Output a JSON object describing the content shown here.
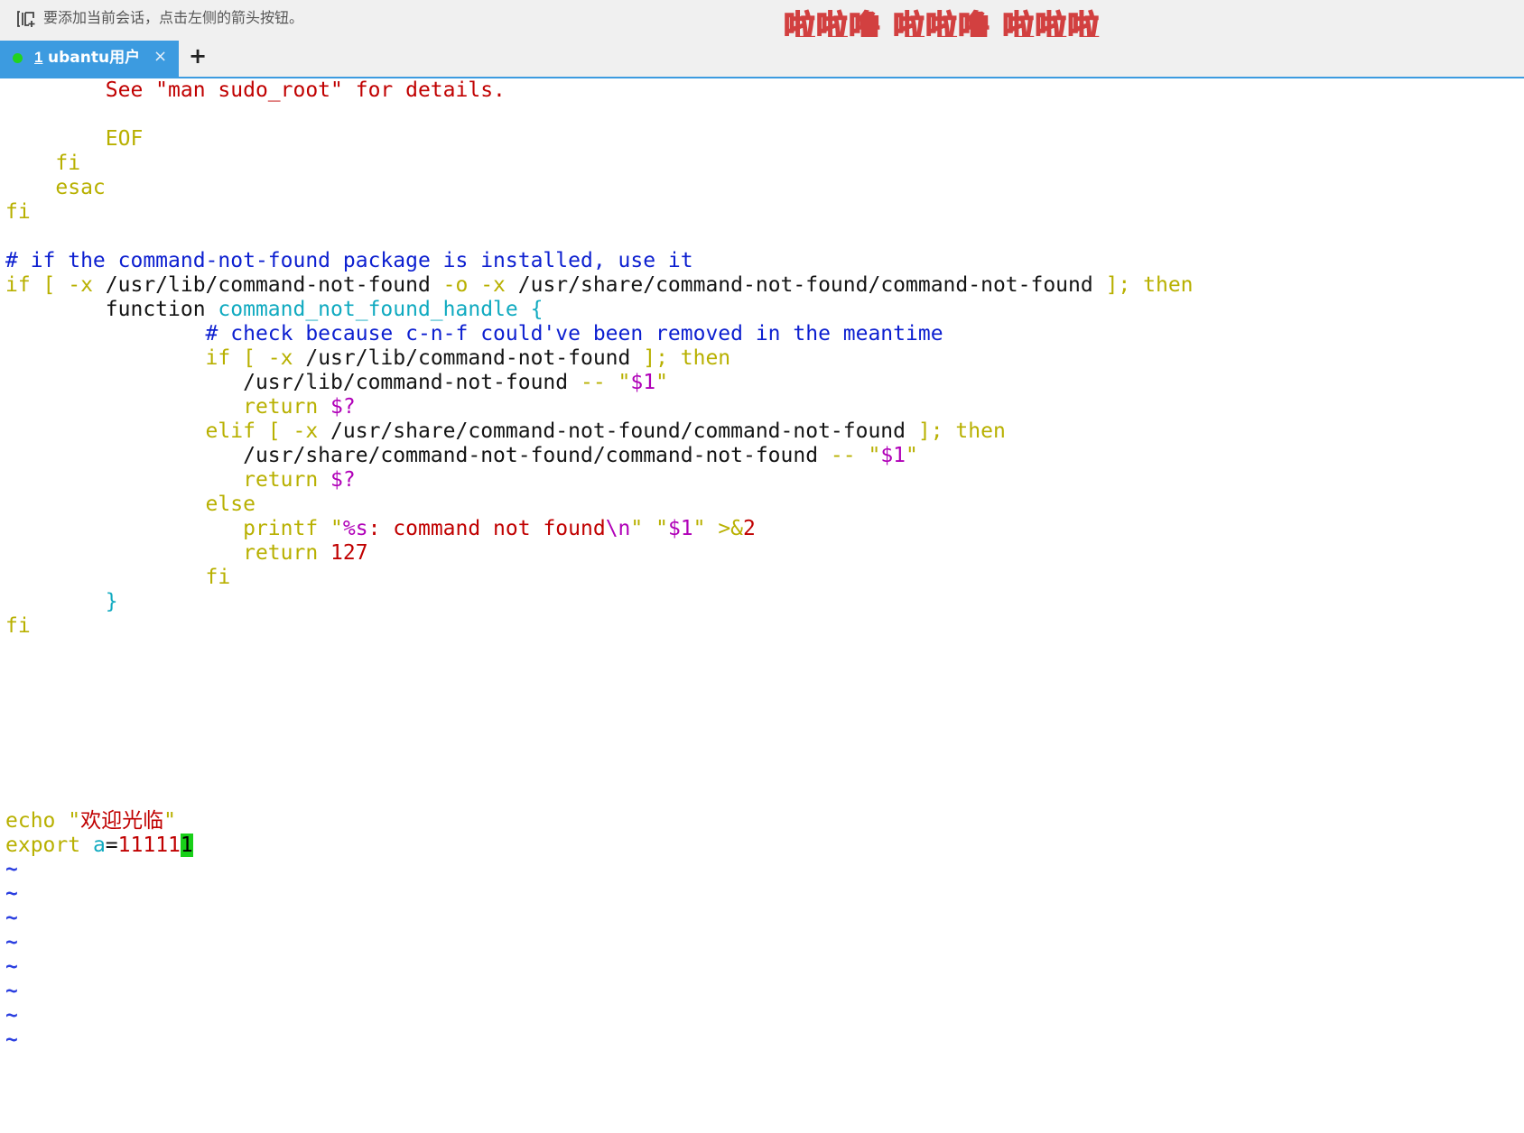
{
  "hint_bar": {
    "text": "要添加当前会话，点击左侧的箭头按钮。",
    "icon": "add-session-icon"
  },
  "watermark": {
    "text": "啦啦噜 啦啦噜 啦啦啦"
  },
  "tabs": [
    {
      "index": "1",
      "label": "ubantu用户",
      "status_color": "#22d31e",
      "close": "×",
      "active": true
    }
  ],
  "new_tab_label": "+",
  "colors": {
    "accent": "#3c9be0",
    "string_red": "#c00000",
    "keyword_olive": "#b8b000",
    "comment_blue": "#0c1fd0",
    "identifier_cyan": "#10aac0",
    "special_magenta": "#b000b8",
    "cursor_green": "#18d018"
  },
  "editor": {
    "lines": [
      {
        "tokens": [
          {
            "t": "        See \"man sudo_root\" for details.",
            "c": "red"
          }
        ]
      },
      {
        "tokens": []
      },
      {
        "tokens": [
          {
            "t": "        EOF",
            "c": "olive"
          }
        ]
      },
      {
        "tokens": [
          {
            "t": "    fi",
            "c": "olive"
          }
        ]
      },
      {
        "tokens": [
          {
            "t": "    esac",
            "c": "olive"
          }
        ]
      },
      {
        "tokens": [
          {
            "t": "fi",
            "c": "olive"
          }
        ]
      },
      {
        "tokens": []
      },
      {
        "tokens": [
          {
            "t": "# if the command-not-found package is installed, use it",
            "c": "blue"
          }
        ]
      },
      {
        "tokens": [
          {
            "t": "if [ -x ",
            "c": "olive"
          },
          {
            "t": "/usr/lib/command-not-found ",
            "c": "black"
          },
          {
            "t": "-o -x ",
            "c": "olive"
          },
          {
            "t": "/usr/share/command-not-found/command-not-found ",
            "c": "black"
          },
          {
            "t": "]; then",
            "c": "olive"
          }
        ]
      },
      {
        "tokens": [
          {
            "t": "        function ",
            "c": "black"
          },
          {
            "t": "command_not_found_handle {",
            "c": "cyan"
          }
        ]
      },
      {
        "tokens": [
          {
            "t": "                # check because c-n-f could've been removed in the meantime",
            "c": "blue"
          }
        ]
      },
      {
        "tokens": [
          {
            "t": "                if [ -x ",
            "c": "olive"
          },
          {
            "t": "/usr/lib/command-not-found ",
            "c": "black"
          },
          {
            "t": "]; then",
            "c": "olive"
          }
        ]
      },
      {
        "tokens": [
          {
            "t": "                   /usr/lib/command-not-found ",
            "c": "black"
          },
          {
            "t": "-- \"",
            "c": "olive"
          },
          {
            "t": "$1",
            "c": "magenta"
          },
          {
            "t": "\"",
            "c": "olive"
          }
        ]
      },
      {
        "tokens": [
          {
            "t": "                   return ",
            "c": "olive"
          },
          {
            "t": "$?",
            "c": "magenta"
          }
        ]
      },
      {
        "tokens": [
          {
            "t": "                elif [ -x ",
            "c": "olive"
          },
          {
            "t": "/usr/share/command-not-found/command-not-found ",
            "c": "black"
          },
          {
            "t": "]; then",
            "c": "olive"
          }
        ]
      },
      {
        "tokens": [
          {
            "t": "                   /usr/share/command-not-found/command-not-found ",
            "c": "black"
          },
          {
            "t": "-- \"",
            "c": "olive"
          },
          {
            "t": "$1",
            "c": "magenta"
          },
          {
            "t": "\"",
            "c": "olive"
          }
        ]
      },
      {
        "tokens": [
          {
            "t": "                   return ",
            "c": "olive"
          },
          {
            "t": "$?",
            "c": "magenta"
          }
        ]
      },
      {
        "tokens": [
          {
            "t": "                else",
            "c": "olive"
          }
        ]
      },
      {
        "tokens": [
          {
            "t": "                   printf \"",
            "c": "olive"
          },
          {
            "t": "%s",
            "c": "magenta"
          },
          {
            "t": ": command not found",
            "c": "red"
          },
          {
            "t": "\\n",
            "c": "magenta"
          },
          {
            "t": "\" \"",
            "c": "olive"
          },
          {
            "t": "$1",
            "c": "magenta"
          },
          {
            "t": "\" >&",
            "c": "olive"
          },
          {
            "t": "2",
            "c": "red"
          }
        ]
      },
      {
        "tokens": [
          {
            "t": "                   return ",
            "c": "olive"
          },
          {
            "t": "127",
            "c": "red"
          }
        ]
      },
      {
        "tokens": [
          {
            "t": "                fi",
            "c": "olive"
          }
        ]
      },
      {
        "tokens": [
          {
            "t": "        }",
            "c": "cyan"
          }
        ]
      },
      {
        "tokens": [
          {
            "t": "fi",
            "c": "olive"
          }
        ]
      },
      {
        "tokens": []
      },
      {
        "tokens": []
      },
      {
        "tokens": []
      },
      {
        "tokens": []
      },
      {
        "tokens": []
      },
      {
        "tokens": []
      },
      {
        "tokens": []
      },
      {
        "tokens": [
          {
            "t": "echo \"",
            "c": "olive"
          },
          {
            "t": "欢迎光临",
            "c": "red",
            "cjk": true
          },
          {
            "t": "\"",
            "c": "olive"
          }
        ]
      },
      {
        "tokens": [
          {
            "t": "export ",
            "c": "olive"
          },
          {
            "t": "a",
            "c": "cyan"
          },
          {
            "t": "=",
            "c": "black"
          },
          {
            "t": "11111",
            "c": "red"
          },
          {
            "t": "1",
            "c": "cursor"
          }
        ]
      },
      {
        "tokens": [
          {
            "t": "~",
            "c": "tilde"
          }
        ]
      },
      {
        "tokens": [
          {
            "t": "~",
            "c": "tilde"
          }
        ]
      },
      {
        "tokens": [
          {
            "t": "~",
            "c": "tilde"
          }
        ]
      },
      {
        "tokens": [
          {
            "t": "~",
            "c": "tilde"
          }
        ]
      },
      {
        "tokens": [
          {
            "t": "~",
            "c": "tilde"
          }
        ]
      },
      {
        "tokens": [
          {
            "t": "~",
            "c": "tilde"
          }
        ]
      },
      {
        "tokens": [
          {
            "t": "~",
            "c": "tilde"
          }
        ]
      },
      {
        "tokens": [
          {
            "t": "~",
            "c": "tilde"
          }
        ]
      }
    ]
  }
}
